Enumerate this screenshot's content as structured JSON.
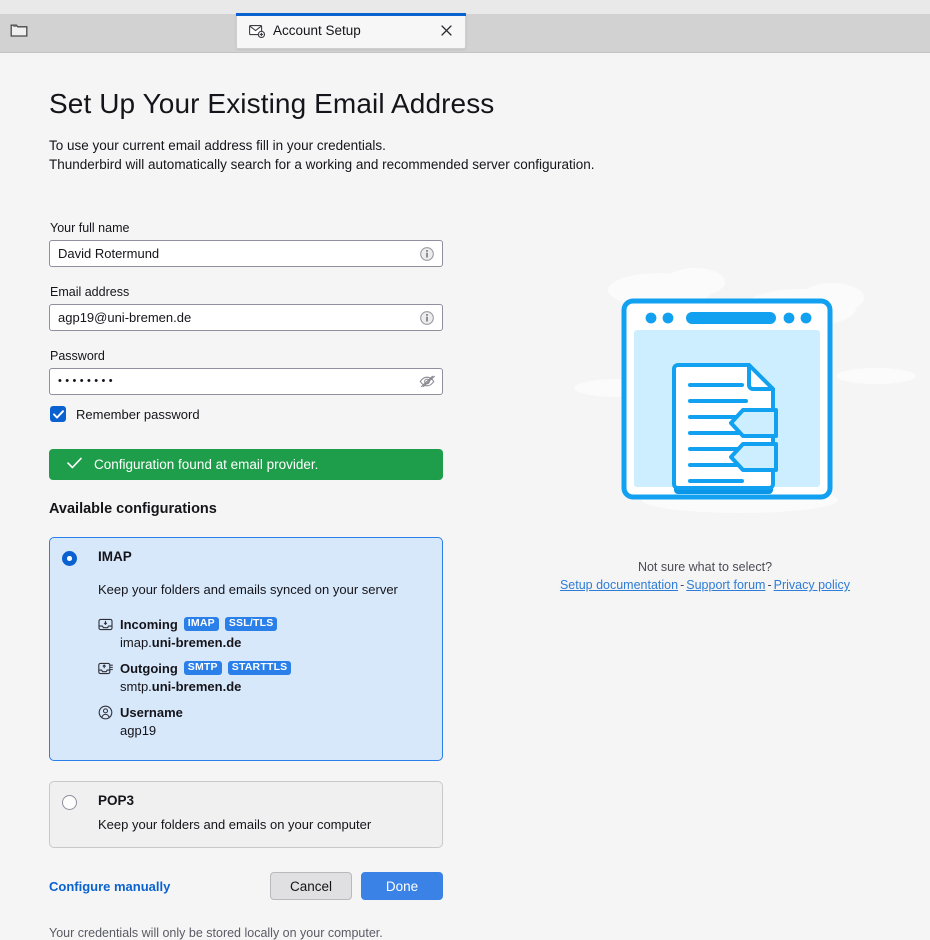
{
  "window": {
    "tab": {
      "label": "Account Setup",
      "icon": "mail-setup-icon",
      "close_icon": "close-icon"
    },
    "toolbar_icon": "folder-icon"
  },
  "page": {
    "title": "Set Up Your Existing Email Address",
    "intro_line1": "To use your current email address fill in your credentials.",
    "intro_line2": "Thunderbird will automatically search for a working and recommended server configuration."
  },
  "form": {
    "name": {
      "label": "Your full name",
      "value": "David Rotermund",
      "placeholder": "",
      "adorn_icon": "info-icon"
    },
    "email": {
      "label": "Email address",
      "value": "agp19@uni-bremen.de",
      "placeholder": "",
      "adorn_icon": "info-icon"
    },
    "password": {
      "label": "Password",
      "value": "••••••••",
      "placeholder": "",
      "adorn_icon": "eye-slash-icon"
    },
    "remember": {
      "label": "Remember password",
      "checked": true,
      "icon": "checkmark-icon"
    }
  },
  "status": {
    "icon": "checkmark-icon",
    "text": "Configuration found at email provider.",
    "color": "#1e9e4a"
  },
  "configurations": {
    "heading": "Available configurations",
    "items": [
      {
        "id": "imap",
        "title": "IMAP",
        "description": "Keep your folders and emails synced on your server",
        "selected": true,
        "details": [
          {
            "icon": "inbox-icon",
            "label": "Incoming",
            "badges": [
              "IMAP",
              "SSL/TLS"
            ],
            "value_prefix": "imap.",
            "value_domain": "uni-bremen.de"
          },
          {
            "icon": "outbox-icon",
            "label": "Outgoing",
            "badges": [
              "SMTP",
              "STARTTLS"
            ],
            "value_prefix": "smtp.",
            "value_domain": "uni-bremen.de"
          },
          {
            "icon": "person-icon",
            "label": "Username",
            "badges": [],
            "value_prefix": "agp19",
            "value_domain": ""
          }
        ]
      },
      {
        "id": "pop3",
        "title": "POP3",
        "description": "Keep your folders and emails on your computer",
        "selected": false,
        "details": []
      }
    ]
  },
  "actions": {
    "configure_manually": "Configure manually",
    "cancel": "Cancel",
    "done": "Done",
    "footnote": "Your credentials will only be stored locally on your computer."
  },
  "help": {
    "illustration_icon": "browser-document-illustration",
    "title": "Not sure what to select?",
    "links": [
      "Setup documentation",
      "Support forum",
      "Privacy policy"
    ],
    "separator": "-"
  },
  "colors": {
    "accent": "#0a62d0",
    "badge": "#2b7fe8",
    "success": "#1e9e4a",
    "primary_button": "#3a82e6",
    "selected_card_bg": "#d7e8fb"
  }
}
